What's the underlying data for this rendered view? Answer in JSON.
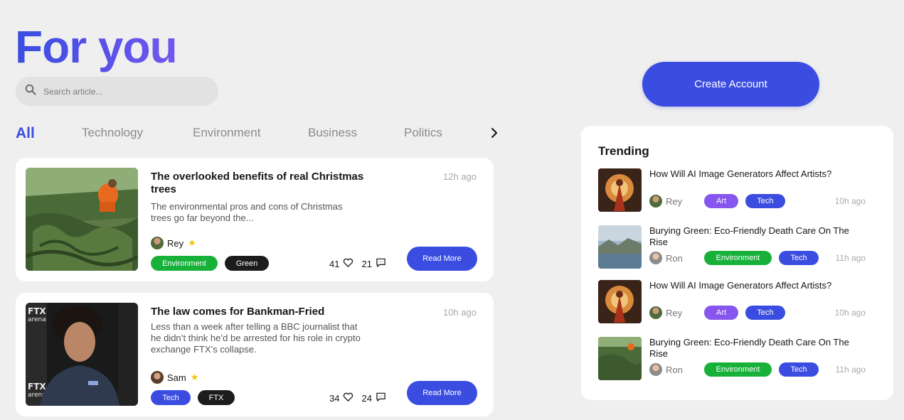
{
  "page": {
    "title": "For you"
  },
  "search": {
    "placeholder": "Search article..."
  },
  "categories": [
    "All",
    "Technology",
    "Environment",
    "Business",
    "Politics"
  ],
  "articles": [
    {
      "title": "The overlooked benefits of real Christmas trees",
      "excerpt": "The environmental pros and cons of Christmas trees go far beyond the...",
      "time": "12h ago",
      "author": "Rey",
      "tags": [
        "Environment",
        "Green"
      ],
      "likes": "41",
      "comments": "21",
      "read_more": "Read More"
    },
    {
      "title": "The law comes for Bankman-Fried",
      "excerpt": "Less than a week after telling a BBC journalist that he didn’t think he’d be arrested for his role in crypto exchange FTX’s collapse.",
      "time": "10h ago",
      "author": "Sam",
      "tags": [
        "Tech",
        "FTX"
      ],
      "likes": "34",
      "comments": "24",
      "read_more": "Read More",
      "image_text": [
        "FTX",
        "arena",
        "FTX",
        "arena"
      ]
    }
  ],
  "account": {
    "create_label": "Create Account"
  },
  "trending": {
    "heading": "Trending",
    "items": [
      {
        "title": "How Will AI Image Generators Affect Artists?",
        "author": "Rey",
        "tags": [
          "Art",
          "Tech"
        ],
        "time": "10h ago"
      },
      {
        "title": "Burying Green: Eco-Friendly Death Care On The Rise",
        "author": "Ron",
        "tags": [
          "Environment",
          "Tech"
        ],
        "time": "11h ago"
      },
      {
        "title": "How Will AI Image Generators Affect Artists?",
        "author": "Rey",
        "tags": [
          "Art",
          "Tech"
        ],
        "time": "10h ago"
      },
      {
        "title": "Burying Green: Eco-Friendly Death Care On The Rise",
        "author": "Ron",
        "tags": [
          "Environment",
          "Tech"
        ],
        "time": "11h ago"
      }
    ]
  },
  "colors": {
    "accent": "#3a4de0",
    "purple": "#8656ee",
    "green": "#17b13a",
    "black": "#1c1c1c",
    "star": "#f2c40d"
  }
}
